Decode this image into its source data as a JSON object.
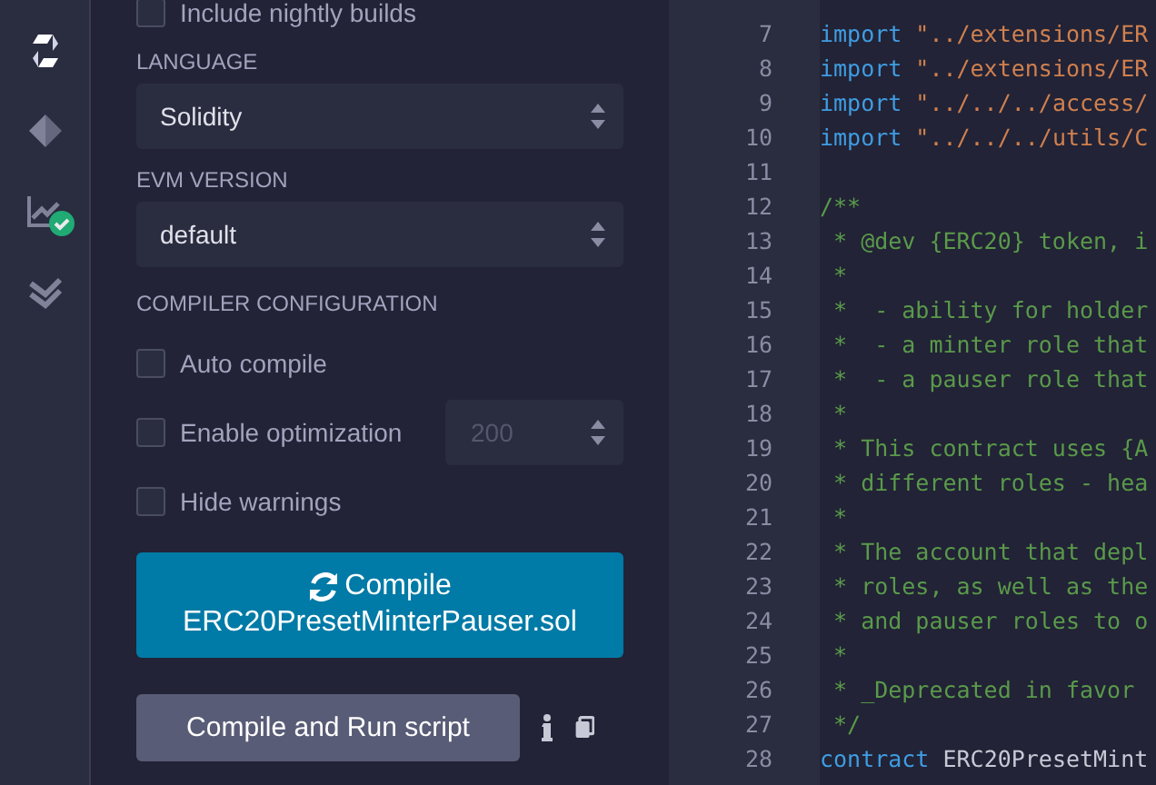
{
  "icon_bar": {
    "items": [
      {
        "kind": "solidity",
        "selected": true
      },
      {
        "kind": "deploy",
        "selected": false
      },
      {
        "kind": "analysis",
        "selected": false,
        "passed": true
      },
      {
        "kind": "verify",
        "selected": false
      }
    ]
  },
  "compiler_panel": {
    "nightly": {
      "label": "Include nightly builds",
      "checked": false
    },
    "language": {
      "label": "LANGUAGE",
      "value": "Solidity"
    },
    "evm_version": {
      "label": "EVM VERSION",
      "value": "default"
    },
    "configuration": {
      "label": "COMPILER CONFIGURATION",
      "options": [
        {
          "label": "Auto compile",
          "checked": false
        },
        {
          "label": "Enable optimization",
          "checked": false,
          "runs": "200",
          "disabled": true
        },
        {
          "label": "Hide warnings",
          "checked": false
        }
      ]
    },
    "compile_button": {
      "line_1": "Compile",
      "line_2": "ERC20PresetMinterPauser.sol"
    },
    "run_script_button": "Compile and Run script"
  },
  "editor": {
    "lines": [
      {
        "number": "7",
        "tokens": [
          {
            "kind": "keyword",
            "text": "import"
          },
          {
            "kind": "string",
            "text": " \"../extensions/ER"
          }
        ]
      },
      {
        "number": "8",
        "tokens": [
          {
            "kind": "keyword",
            "text": "import"
          },
          {
            "kind": "string",
            "text": " \"../extensions/ER"
          }
        ]
      },
      {
        "number": "9",
        "tokens": [
          {
            "kind": "keyword",
            "text": "import"
          },
          {
            "kind": "string",
            "text": " \"../../../access/"
          }
        ]
      },
      {
        "number": "10",
        "tokens": [
          {
            "kind": "keyword",
            "text": "import"
          },
          {
            "kind": "string",
            "text": " \"../../../utils/C"
          }
        ]
      },
      {
        "number": "11"
      },
      {
        "number": "12",
        "tokens": [
          {
            "kind": "comment",
            "text": "/**"
          }
        ]
      },
      {
        "number": "13",
        "tokens": [
          {
            "kind": "comment",
            "text": " * @dev {ERC20} token, i"
          }
        ]
      },
      {
        "number": "14",
        "tokens": [
          {
            "kind": "comment",
            "text": " *"
          }
        ]
      },
      {
        "number": "15",
        "tokens": [
          {
            "kind": "comment",
            "text": " *  - ability for holder"
          }
        ]
      },
      {
        "number": "16",
        "tokens": [
          {
            "kind": "comment",
            "text": " *  - a minter role that"
          }
        ]
      },
      {
        "number": "17",
        "tokens": [
          {
            "kind": "comment",
            "text": " *  - a pauser role that"
          }
        ]
      },
      {
        "number": "18",
        "tokens": [
          {
            "kind": "comment",
            "text": " *"
          }
        ]
      },
      {
        "number": "19",
        "tokens": [
          {
            "kind": "comment",
            "text": " * This contract uses {A"
          }
        ]
      },
      {
        "number": "20",
        "tokens": [
          {
            "kind": "comment",
            "text": " * different roles - hea"
          }
        ]
      },
      {
        "number": "21",
        "tokens": [
          {
            "kind": "comment",
            "text": " *"
          }
        ]
      },
      {
        "number": "22",
        "tokens": [
          {
            "kind": "comment",
            "text": " * The account that depl"
          }
        ]
      },
      {
        "number": "23",
        "tokens": [
          {
            "kind": "comment",
            "text": " * roles, as well as the"
          }
        ]
      },
      {
        "number": "24",
        "tokens": [
          {
            "kind": "comment",
            "text": " * and pauser roles to o"
          }
        ]
      },
      {
        "number": "25",
        "tokens": [
          {
            "kind": "comment",
            "text": " *"
          }
        ]
      },
      {
        "number": "26",
        "tokens": [
          {
            "kind": "comment",
            "text": " * _Deprecated in favor"
          }
        ]
      },
      {
        "number": "27",
        "tokens": [
          {
            "kind": "comment",
            "text": " */"
          }
        ]
      },
      {
        "number": "28",
        "tokens": [
          {
            "kind": "keyword",
            "text": "contract"
          },
          {
            "kind": "plain",
            "text": " ERC20PresetMint"
          }
        ]
      }
    ]
  }
}
